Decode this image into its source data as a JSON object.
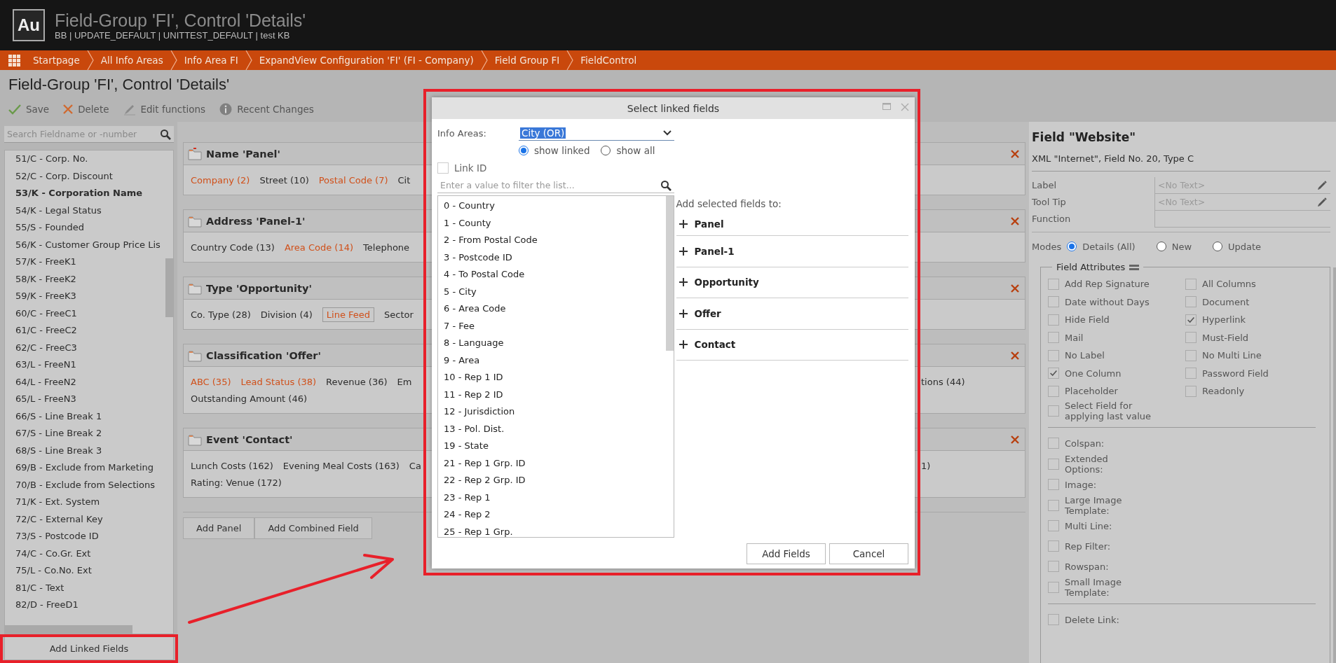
{
  "app": {
    "logo": "Au",
    "title": "Field-Group 'FI', Control 'Details'",
    "subtitle": "BB | UPDATE_DEFAULT | UNITTEST_DEFAULT | test KB"
  },
  "breadcrumb": [
    "Startpage",
    "All Info Areas",
    "Info Area FI",
    "ExpandView Configuration 'FI' (FI - Company)",
    "Field Group FI",
    "FieldControl"
  ],
  "page_title": "Field-Group 'FI', Control 'Details'",
  "toolbar": [
    {
      "kind": "save",
      "label": "Save"
    },
    {
      "kind": "delete",
      "label": "Delete"
    },
    {
      "kind": "edit",
      "label": "Edit functions"
    },
    {
      "kind": "info",
      "label": "Recent Changes"
    }
  ],
  "field_list": {
    "search_placeholder": "Search Fieldname or -number",
    "items": [
      {
        "label": "51/C - Corp. No.",
        "selected": false
      },
      {
        "label": "52/C - Corp. Discount",
        "selected": false
      },
      {
        "label": "53/K - Corporation Name",
        "selected": true
      },
      {
        "label": "54/K - Legal Status",
        "selected": false
      },
      {
        "label": "55/S - Founded",
        "selected": false
      },
      {
        "label": "56/K - Customer Group Price Lis",
        "selected": false
      },
      {
        "label": "57/K - FreeK1",
        "selected": false
      },
      {
        "label": "58/K - FreeK2",
        "selected": false
      },
      {
        "label": "59/K - FreeK3",
        "selected": false
      },
      {
        "label": "60/C - FreeC1",
        "selected": false
      },
      {
        "label": "61/C - FreeC2",
        "selected": false
      },
      {
        "label": "62/C - FreeC3",
        "selected": false
      },
      {
        "label": "63/L - FreeN1",
        "selected": false
      },
      {
        "label": "64/L - FreeN2",
        "selected": false
      },
      {
        "label": "65/L - FreeN3",
        "selected": false
      },
      {
        "label": "66/S - Line Break 1",
        "selected": false
      },
      {
        "label": "67/S - Line Break 2",
        "selected": false
      },
      {
        "label": "68/S - Line Break 3",
        "selected": false
      },
      {
        "label": "69/B - Exclude from Marketing",
        "selected": false
      },
      {
        "label": "70/B - Exclude from Selections",
        "selected": false
      },
      {
        "label": "71/K - Ext. System",
        "selected": false
      },
      {
        "label": "72/C - External Key",
        "selected": false
      },
      {
        "label": "73/S - Postcode ID",
        "selected": false
      },
      {
        "label": "74/C - Co.Gr. Ext",
        "selected": false
      },
      {
        "label": "75/L - Co.No. Ext",
        "selected": false
      },
      {
        "label": "81/C - Text",
        "selected": false
      },
      {
        "label": "82/D - FreeD1",
        "selected": false
      }
    ],
    "add_button": "Add Linked Fields"
  },
  "panels": [
    {
      "kind": "panel",
      "title": "Name 'Panel'",
      "rows": [
        {
          "fields": [
            {
              "label": "Company (2)",
              "highlighted": true,
              "boxed": false
            },
            {
              "label": "Street (10)",
              "highlighted": false,
              "boxed": false
            },
            {
              "label": "Postal Code (7)",
              "highlighted": true,
              "boxed": false
            },
            {
              "label": "Cit",
              "highlighted": false,
              "boxed": false
            }
          ]
        }
      ]
    },
    {
      "kind": "folder",
      "title": "Address 'Panel-1'",
      "rows": [
        {
          "fields": [
            {
              "label": "Country Code (13)",
              "highlighted": false,
              "boxed": false
            },
            {
              "label": "Area Code (14)",
              "highlighted": true,
              "boxed": false
            },
            {
              "label": "Telephone",
              "highlighted": false,
              "boxed": false
            }
          ]
        }
      ]
    },
    {
      "kind": "folder",
      "title": "Type 'Opportunity'",
      "rows": [
        {
          "fields": [
            {
              "label": "Co. Type (28)",
              "highlighted": false,
              "boxed": false
            },
            {
              "label": "Division (4)",
              "highlighted": false,
              "boxed": false
            },
            {
              "label": "Line Feed",
              "highlighted": true,
              "boxed": true
            },
            {
              "label": "Sector",
              "highlighted": false,
              "boxed": false
            }
          ]
        }
      ]
    },
    {
      "kind": "folder",
      "title": "Classification 'Offer'",
      "rows": [
        {
          "fields": [
            {
              "label": "ABC (35)",
              "highlighted": true,
              "boxed": false
            },
            {
              "label": "Lead Status (38)",
              "highlighted": true,
              "boxed": false
            },
            {
              "label": "Revenue (36)",
              "highlighted": false,
              "boxed": false
            },
            {
              "label": "Em",
              "highlighted": false,
              "boxed": false
            }
          ],
          "tail": "tions (44)"
        },
        {
          "fields": [
            {
              "label": "Outstanding Amount (46)",
              "highlighted": false,
              "boxed": false
            }
          ]
        }
      ]
    },
    {
      "kind": "folder",
      "title": "Event 'Contact'",
      "rows": [
        {
          "fields": [
            {
              "label": "Lunch Costs (162)",
              "highlighted": false,
              "boxed": false
            },
            {
              "label": "Evening Meal Costs (163)",
              "highlighted": false,
              "boxed": false
            },
            {
              "label": "Ca",
              "highlighted": false,
              "boxed": false
            }
          ],
          "tail": "1)"
        },
        {
          "fields": [
            {
              "label": "Rating: Venue (172)",
              "highlighted": false,
              "boxed": false
            }
          ]
        }
      ]
    }
  ],
  "panel_buttons": [
    "Add Panel",
    "Add Combined Field"
  ],
  "dialog": {
    "title": "Select linked fields",
    "info_areas_label": "Info Areas:",
    "info_area_value": "City (OR)",
    "view_options": [
      {
        "label": "show linked",
        "selected": true
      },
      {
        "label": "show all",
        "selected": false
      }
    ],
    "link_id": {
      "label": "Link ID",
      "checked": false
    },
    "filter_placeholder": "Enter a value to filter the list...",
    "fields": [
      "0 - Country",
      "1 - County",
      "2 - From Postal Code",
      "3 - Postcode ID",
      "4 - To Postal Code",
      "5 - City",
      "6 - Area Code",
      "7 - Fee",
      "8 - Language",
      "9 - Area",
      "10 - Rep 1 ID",
      "11 - Rep 2 ID",
      "12 - Jurisdiction",
      "13 - Pol. Dist.",
      "19 - State",
      "21 - Rep 1 Grp. ID",
      "22 - Rep 2 Grp. ID",
      "23 - Rep 1",
      "24 - Rep 2",
      "25 - Rep 1 Grp."
    ],
    "targets_label": "Add selected fields to:",
    "targets": [
      "Panel",
      "Panel-1",
      "Opportunity",
      "Offer",
      "Contact"
    ],
    "buttons": [
      "Add Fields",
      "Cancel"
    ]
  },
  "details": {
    "title": "Field \"Website\"",
    "subtitle": "XML \"Internet\", Field No. 20, Type C",
    "properties": [
      {
        "label": "Label",
        "placeholder": "<No Text>",
        "editable": true
      },
      {
        "label": "Tool Tip",
        "placeholder": "<No Text>",
        "editable": true
      },
      {
        "label": "Function",
        "editable": false
      }
    ],
    "modes_label": "Modes",
    "modes": [
      {
        "label": "Details (All)",
        "selected": true
      },
      {
        "label": "New",
        "selected": false
      },
      {
        "label": "Update",
        "selected": false
      }
    ],
    "attributes_title": "Field Attributes",
    "attributes": [
      {
        "label": "Add Rep Signature",
        "checked": false
      },
      {
        "label": "All Columns",
        "checked": false
      },
      {
        "label": "Date without Days",
        "checked": false
      },
      {
        "label": "Document",
        "checked": false
      },
      {
        "label": "Hide Field",
        "checked": false
      },
      {
        "label": "Hyperlink",
        "checked": true
      },
      {
        "label": "Mail",
        "checked": false
      },
      {
        "label": "Must-Field",
        "checked": false
      },
      {
        "label": "No Label",
        "checked": false
      },
      {
        "label": "No Multi Line",
        "checked": false
      },
      {
        "label": "One Column",
        "checked": true
      },
      {
        "label": "Password Field",
        "checked": false
      },
      {
        "label": "Placeholder",
        "checked": false
      },
      {
        "label": "Readonly",
        "checked": false
      },
      {
        "label": "Select Field for applying last value",
        "checked": false
      }
    ],
    "options": [
      {
        "label": "Colspan:",
        "checked": false
      },
      {
        "label": "Extended Options:",
        "checked": false
      },
      {
        "label": "Image:",
        "checked": false
      },
      {
        "label": "Large Image Template:",
        "checked": false
      },
      {
        "label": "Multi Line:",
        "checked": false
      },
      {
        "label": "Rep Filter:",
        "checked": false
      },
      {
        "label": "Rowspan:",
        "checked": false
      },
      {
        "label": "Small Image Template:",
        "checked": false
      }
    ],
    "links": [
      {
        "label": "Delete Link:",
        "checked": false
      }
    ]
  }
}
